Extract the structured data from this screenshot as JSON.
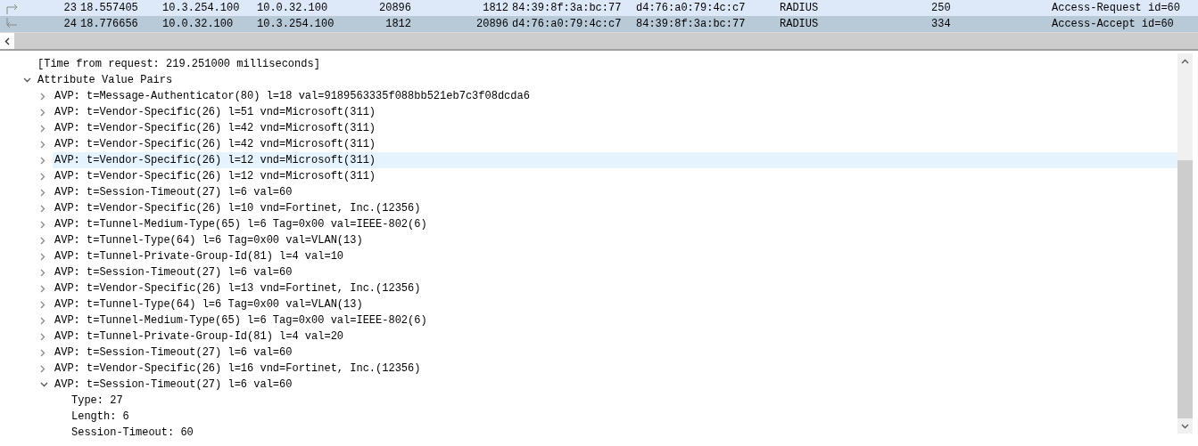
{
  "packet_list": {
    "rows": [
      {
        "kind": "request",
        "selected": false,
        "cells": [
          "23",
          "18.557405",
          "10.3.254.100",
          "10.0.32.100",
          "20896",
          "1812",
          "84:39:8f:3a:bc:77",
          "d4:76:a0:79:4c:c7",
          "RADIUS",
          "250",
          "Access-Request id=60"
        ]
      },
      {
        "kind": "response",
        "selected": true,
        "cells": [
          "24",
          "18.776656",
          "10.0.32.100",
          "10.3.254.100",
          "1812",
          "20896",
          "d4:76:a0:79:4c:c7",
          "84:39:8f:3a:bc:77",
          "RADIUS",
          "334",
          "Access-Accept id=60"
        ]
      }
    ]
  },
  "details": {
    "tree": [
      {
        "label": "[Time from request: 219.251000 milliseconds]",
        "highlighted": false
      },
      {
        "label": "Attribute Value Pairs",
        "expanded": true,
        "highlighted": false,
        "children": [
          {
            "label": "AVP: t=Message-Authenticator(80) l=18 val=9189563335f088bb521eb7c3f08dcda6",
            "expanded": false,
            "highlighted": false
          },
          {
            "label": "AVP: t=Vendor-Specific(26) l=51 vnd=Microsoft(311)",
            "expanded": false,
            "highlighted": false
          },
          {
            "label": "AVP: t=Vendor-Specific(26) l=42 vnd=Microsoft(311)",
            "expanded": false,
            "highlighted": false
          },
          {
            "label": "AVP: t=Vendor-Specific(26) l=42 vnd=Microsoft(311)",
            "expanded": false,
            "highlighted": false
          },
          {
            "label": "AVP: t=Vendor-Specific(26) l=12 vnd=Microsoft(311)",
            "expanded": false,
            "highlighted": true
          },
          {
            "label": "AVP: t=Vendor-Specific(26) l=12 vnd=Microsoft(311)",
            "expanded": false,
            "highlighted": false
          },
          {
            "label": "AVP: t=Session-Timeout(27) l=6 val=60",
            "expanded": false,
            "highlighted": false
          },
          {
            "label": "AVP: t=Vendor-Specific(26) l=10 vnd=Fortinet, Inc.(12356)",
            "expanded": false,
            "highlighted": false
          },
          {
            "label": "AVP: t=Tunnel-Medium-Type(65) l=6 Tag=0x00 val=IEEE-802(6)",
            "expanded": false,
            "highlighted": false
          },
          {
            "label": "AVP: t=Tunnel-Type(64) l=6 Tag=0x00 val=VLAN(13)",
            "expanded": false,
            "highlighted": false
          },
          {
            "label": "AVP: t=Tunnel-Private-Group-Id(81) l=4 val=10",
            "expanded": false,
            "highlighted": false
          },
          {
            "label": "AVP: t=Session-Timeout(27) l=6 val=60",
            "expanded": false,
            "highlighted": false
          },
          {
            "label": "AVP: t=Vendor-Specific(26) l=13 vnd=Fortinet, Inc.(12356)",
            "expanded": false,
            "highlighted": false
          },
          {
            "label": "AVP: t=Tunnel-Type(64) l=6 Tag=0x00 val=VLAN(13)",
            "expanded": false,
            "highlighted": false
          },
          {
            "label": "AVP: t=Tunnel-Medium-Type(65) l=6 Tag=0x00 val=IEEE-802(6)",
            "expanded": false,
            "highlighted": false
          },
          {
            "label": "AVP: t=Tunnel-Private-Group-Id(81) l=4 val=20",
            "expanded": false,
            "highlighted": false
          },
          {
            "label": "AVP: t=Session-Timeout(27) l=6 val=60",
            "expanded": false,
            "highlighted": false
          },
          {
            "label": "AVP: t=Vendor-Specific(26) l=16 vnd=Fortinet, Inc.(12356)",
            "expanded": false,
            "highlighted": false
          },
          {
            "label": "AVP: t=Session-Timeout(27) l=6 val=60",
            "expanded": true,
            "highlighted": false,
            "children": [
              {
                "label": "Type: 27",
                "highlighted": false
              },
              {
                "label": "Length: 6",
                "highlighted": false
              },
              {
                "label": "Session-Timeout: 60",
                "highlighted": false
              }
            ]
          }
        ]
      }
    ]
  }
}
